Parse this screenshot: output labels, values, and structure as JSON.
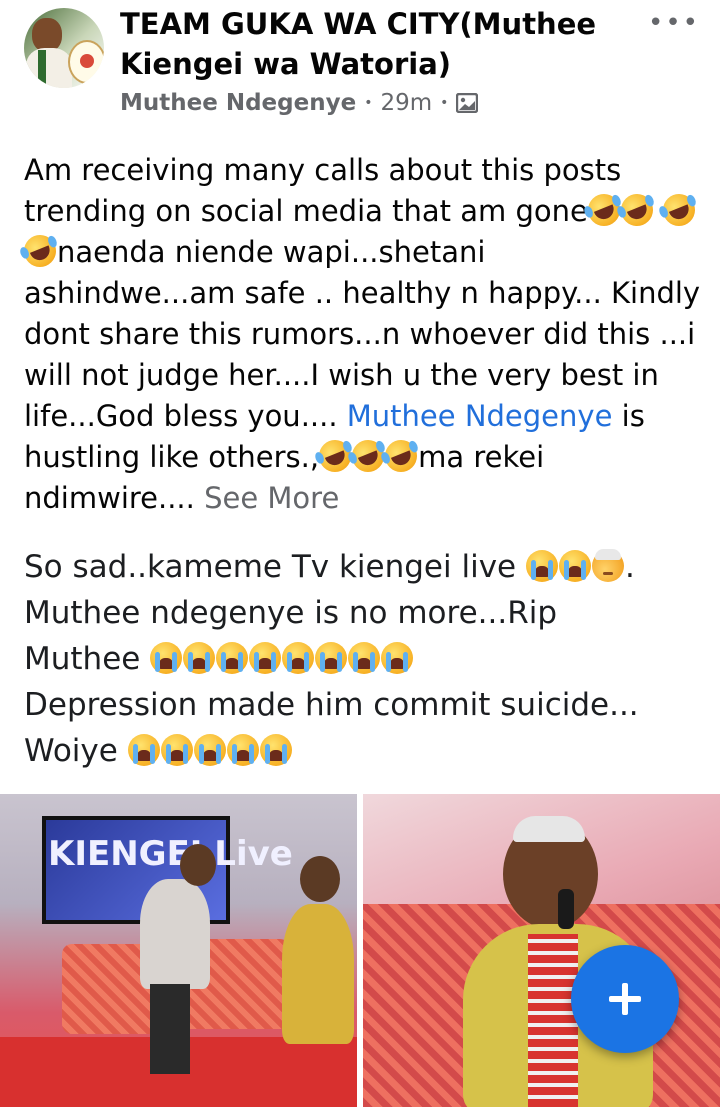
{
  "post": {
    "group_name": "TEAM GUKA WA CITY(Muthee Kiengei wa Watoria)",
    "author": "Muthee Ndegenye",
    "separator": "•",
    "time": "29m",
    "privacy_icon": "photo-album-icon",
    "more_label": "•••",
    "text_part1": "Am receiving many calls about this posts trending on social media that am gone",
    "text_part2": "naenda niende wapi...shetani ashindwe...am safe .. healthy n happy... Kindly dont share this rumors...n whoever did this ...i will not judge her....I wish u the very best in life...God bless you....",
    "mention": "Muthee Ndegenye",
    "text_part3": "is hustling like others.,",
    "text_part4": "ma rekei ndimwire....",
    "see_more": "See More"
  },
  "shared_post": {
    "line1": "So sad..kameme Tv kiengei live",
    "line1_end": ".",
    "line2": "Muthee ndegenye is no more...Rip",
    "line3": "Muthee",
    "line4": "Depression made him commit suicide...",
    "line5": "Woiye"
  },
  "photos": {
    "left_screen_text": "KIENGEI Live"
  },
  "fab": {
    "icon": "plus-icon"
  },
  "colors": {
    "link": "#216fdb",
    "secondary": "#65676b",
    "fab": "#1b74e4"
  }
}
